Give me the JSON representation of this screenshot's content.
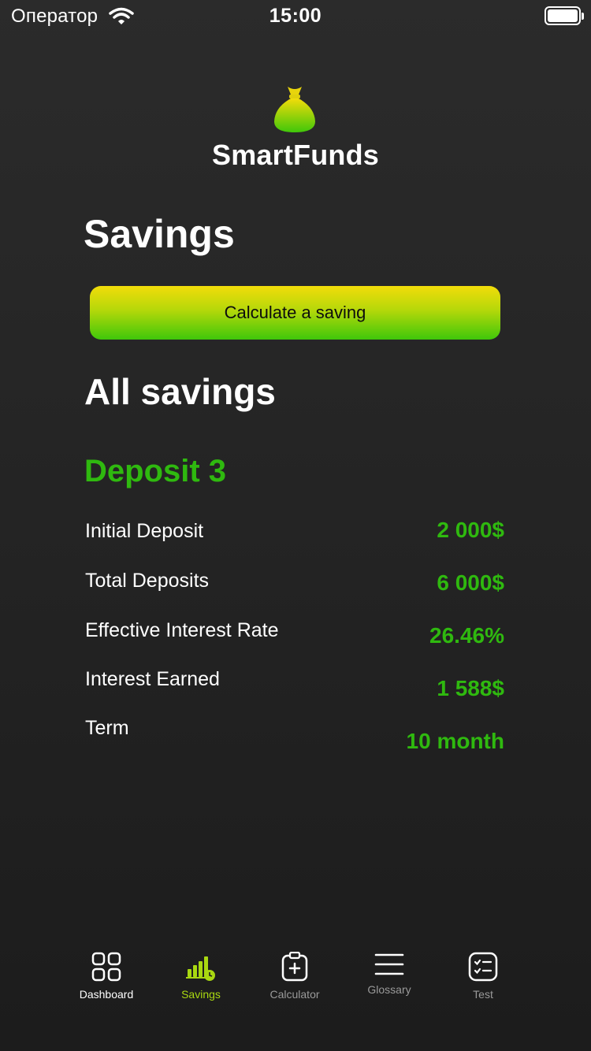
{
  "status_bar": {
    "carrier": "Оператор",
    "time": "15:00",
    "icons": [
      "wifi-icon",
      "battery-icon"
    ]
  },
  "brand": {
    "name": "SmartFunds",
    "logo_icon": "money-bag-icon",
    "logo_colors": [
      "#f2dc0a",
      "#3fc70a"
    ]
  },
  "page": {
    "title": "Savings",
    "calculate_button": "Calculate a saving",
    "section_title": "All savings"
  },
  "deposit": {
    "name": "Deposit 3",
    "rows": [
      {
        "label": "Initial Deposit",
        "value": "2 000$"
      },
      {
        "label": "Total Deposits",
        "value": "6 000$"
      },
      {
        "label": "Effective Interest Rate",
        "value": "26.46%"
      },
      {
        "label": "Interest Earned",
        "value": "1 588$"
      },
      {
        "label": "Term",
        "value": "10 month"
      }
    ]
  },
  "tab_bar": {
    "tabs": [
      {
        "label": "Dashboard",
        "icon": "grid-icon"
      },
      {
        "label": "Savings",
        "icon": "bar-chart-clock-icon",
        "active": true
      },
      {
        "label": "Calculator",
        "icon": "clipboard-plus-icon"
      },
      {
        "label": "Glossary",
        "icon": "menu-lines-icon"
      },
      {
        "label": "Test",
        "icon": "checklist-icon"
      }
    ]
  },
  "colors": {
    "accent_green": "#2fb90f",
    "active_tab": "#a9d811",
    "inactive_tab": "#9a9a9a",
    "background": "#232323"
  }
}
